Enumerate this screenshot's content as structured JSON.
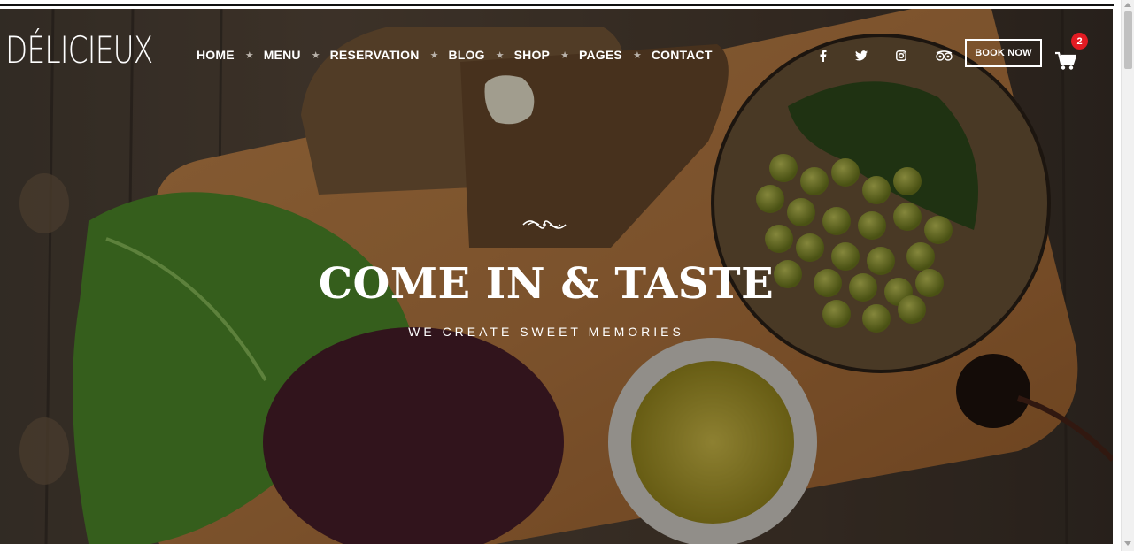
{
  "brand": {
    "logo": "DÉLICIEUX"
  },
  "nav": {
    "items": [
      "HOME",
      "MENU",
      "RESERVATION",
      "BLOG",
      "SHOP",
      "PAGES",
      "CONTACT"
    ],
    "separator": "★"
  },
  "social": {
    "icons": [
      "facebook-icon",
      "twitter-icon",
      "instagram-icon",
      "tripadvisor-icon"
    ]
  },
  "header": {
    "book_label": "BOOK NOW",
    "cart_count": "2"
  },
  "hero": {
    "title": "COME IN & TASTE",
    "subtitle": "WE CREATE SWEET MEMORIES"
  },
  "colors": {
    "badge": "#e31b23",
    "overlay": "#000000"
  }
}
